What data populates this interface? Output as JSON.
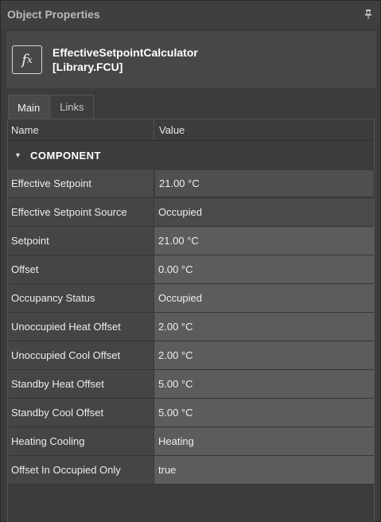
{
  "panel": {
    "title": "Object Properties",
    "pin_icon": "pin-icon"
  },
  "header": {
    "icon": "fx-icon",
    "icon_text": "f",
    "icon_sub": "x",
    "line1": "EffectiveSetpointCalculator",
    "line2": "[Library.FCU]"
  },
  "tabs": [
    {
      "label": "Main",
      "active": true
    },
    {
      "label": "Links",
      "active": false
    }
  ],
  "grid": {
    "col_name": "Name",
    "col_value": "Value",
    "category": {
      "label": "COMPONENT",
      "expanded": true
    },
    "rows": [
      {
        "name": "Effective Setpoint",
        "value": "21.00 °C"
      },
      {
        "name": "Effective Setpoint Source",
        "value": "Occupied"
      },
      {
        "name": "Setpoint",
        "value": "21.00 °C"
      },
      {
        "name": "Offset",
        "value": "0.00 °C"
      },
      {
        "name": "Occupancy Status",
        "value": "Occupied"
      },
      {
        "name": "Unoccupied Heat Offset",
        "value": "2.00 °C"
      },
      {
        "name": "Unoccupied Cool Offset",
        "value": "2.00 °C"
      },
      {
        "name": "Standby Heat Offset",
        "value": "5.00 °C"
      },
      {
        "name": "Standby Cool Offset",
        "value": "5.00 °C"
      },
      {
        "name": "Heating Cooling",
        "value": "Heating"
      },
      {
        "name": "Offset In Occupied Only",
        "value": "true"
      }
    ]
  },
  "colors": {
    "panel_bg": "#3c3c3c",
    "editable_value_bg": "#5c5c5c",
    "readonly_value_bg": "#4a4a4a"
  }
}
